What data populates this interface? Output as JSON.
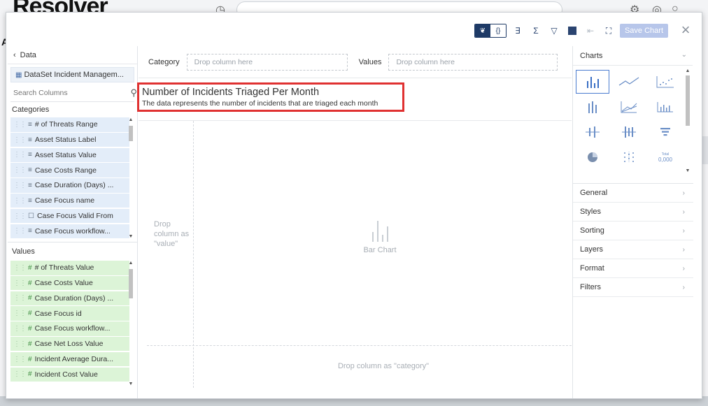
{
  "background": {
    "logo_text": "Resolver",
    "side_letter": "A"
  },
  "toolbar": {
    "save_label": "Save Chart",
    "close_label": "×"
  },
  "left_panel": {
    "header": "Data",
    "dataset": "DataSet Incident Managem...",
    "search_placeholder": "Search Columns",
    "categories_title": "Categories",
    "categories": [
      "# of Threats Range",
      "Asset Status Label",
      "Asset Status Value",
      "Case Costs Range",
      "Case Duration (Days) ...",
      "Case Focus name",
      "Case Focus Valid From",
      "Case Focus workflow..."
    ],
    "values_title": "Values",
    "values": [
      "# of Threats Value",
      "Case Costs Value",
      "Case Duration (Days) ...",
      "Case Focus id",
      "Case Focus workflow...",
      "Case Net Loss Value",
      "Incident Average Dura...",
      "Incident Cost Value"
    ]
  },
  "center": {
    "category_label": "Category",
    "category_drop": "Drop column here",
    "values_label": "Values",
    "values_drop": "Drop column here",
    "chart_title": "Number of Incidents Triaged Per Month",
    "chart_subtitle": "The data represents the number of incidents that are triaged each month",
    "drop_value_hint": "Drop column as \"value\"",
    "placeholder_chart_label": "Bar Chart",
    "drop_category_hint": "Drop column as \"category\""
  },
  "right_panel": {
    "header": "Charts",
    "chart_types": [
      "bar-chart-icon",
      "line-chart-icon",
      "scatter-chart-icon",
      "stacked-bar-chart-icon",
      "area-chart-icon",
      "histogram-chart-icon",
      "box-plot-icon",
      "range-chart-icon",
      "funnel-chart-icon",
      "pie-chart-icon",
      "dot-plot-icon",
      "total-number-icon"
    ],
    "total_tile_text": "0,000",
    "total_tile_caption": "Total",
    "options": [
      "General",
      "Styles",
      "Sorting",
      "Layers",
      "Format",
      "Filters"
    ]
  },
  "colors": {
    "accent_navy": "#1e3a66",
    "highlight_red": "#e03131",
    "category_bg": "#e3edf9",
    "value_bg": "#dcf4d7",
    "save_disabled": "#b7c6ea"
  }
}
